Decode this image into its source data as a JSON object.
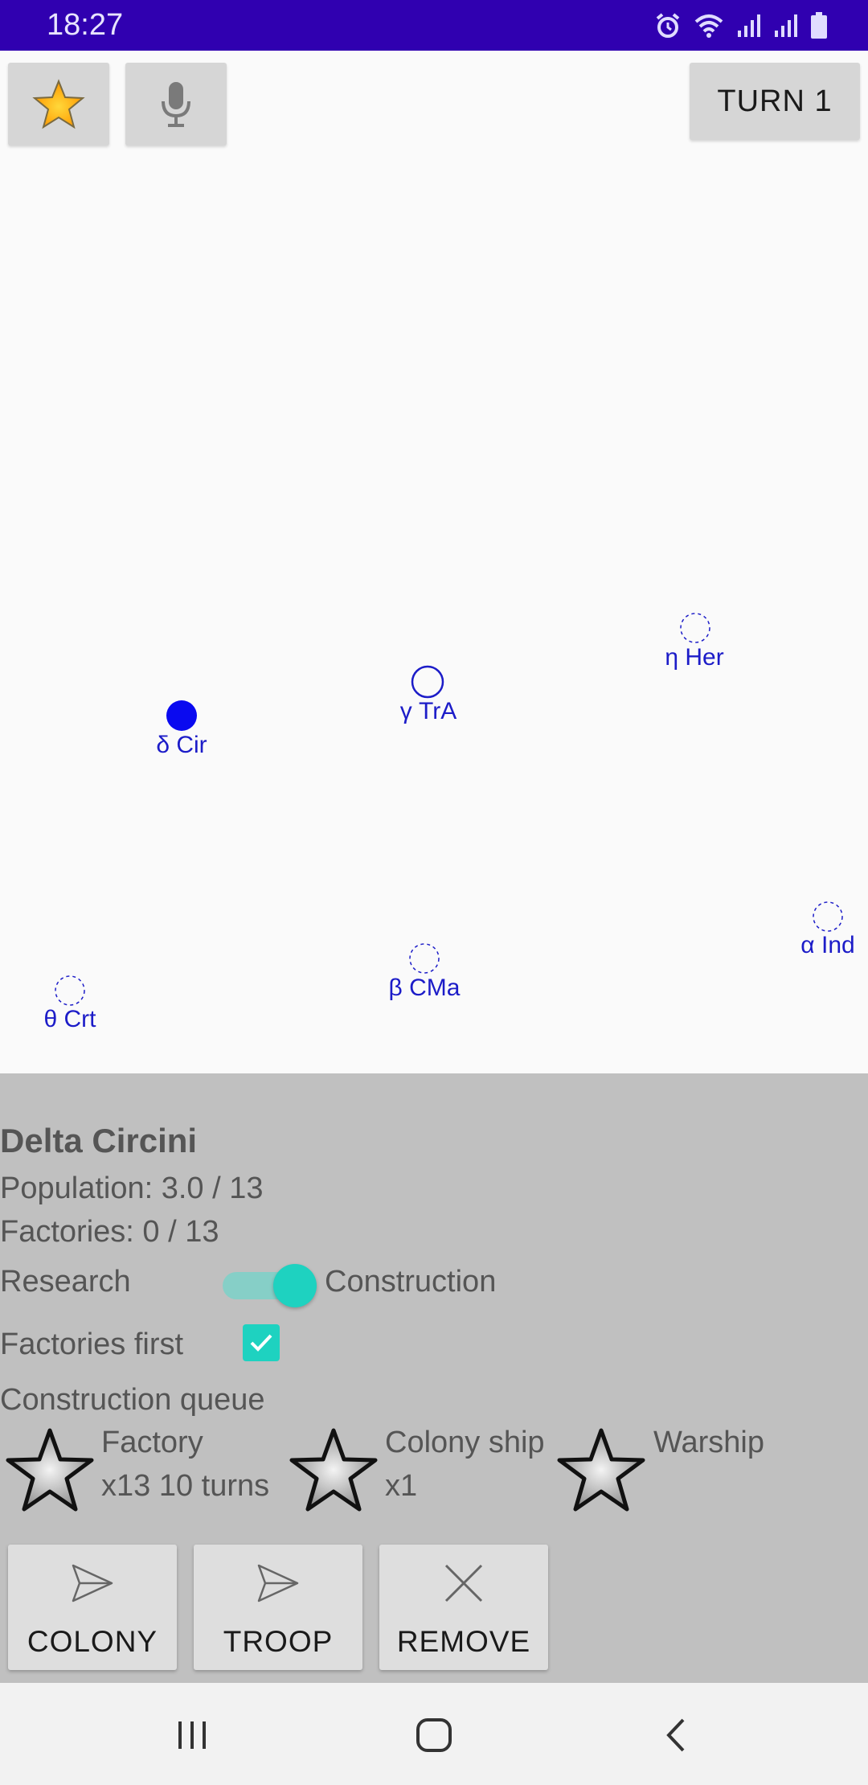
{
  "status_bar": {
    "time": "18:27"
  },
  "toolbar": {
    "star_icon": "star-icon",
    "mic_icon": "microphone-icon",
    "turn_label": "TURN 1"
  },
  "map": {
    "stars": [
      {
        "label": "η Her",
        "state": "unexplored"
      },
      {
        "label": "γ TrA",
        "state": "explored"
      },
      {
        "label": "δ Cir",
        "state": "owned"
      },
      {
        "label": "α Ind",
        "state": "unexplored"
      },
      {
        "label": "β CMa",
        "state": "unexplored"
      },
      {
        "label": "θ Crt",
        "state": "unexplored"
      }
    ]
  },
  "panel": {
    "planet_name": "Delta Circini",
    "population": "Population: 3.0 / 13",
    "factories": "Factories: 0 / 13",
    "switch_left": "Research",
    "switch_right": "Construction",
    "switch_state": "construction",
    "factories_first_label": "Factories first",
    "factories_first_checked": true,
    "queue_label": "Construction queue",
    "queue": [
      {
        "name": "Factory",
        "detail": "x13  10 turns"
      },
      {
        "name": "Colony ship",
        "detail": "x1"
      },
      {
        "name": "Warship",
        "detail": ""
      }
    ]
  },
  "actions": [
    {
      "label": "COLONY",
      "icon": "send-icon"
    },
    {
      "label": "TROOP",
      "icon": "send-icon"
    },
    {
      "label": "REMOVE",
      "icon": "close-icon"
    }
  ],
  "nav": {
    "recents": "recents-icon",
    "home": "home-icon",
    "back": "back-icon"
  },
  "colors": {
    "status_bar": "#3000b0",
    "star_blue": "#1c1cc8",
    "accent": "#1ed2c0",
    "panel_bg": "#c0c0c0"
  }
}
